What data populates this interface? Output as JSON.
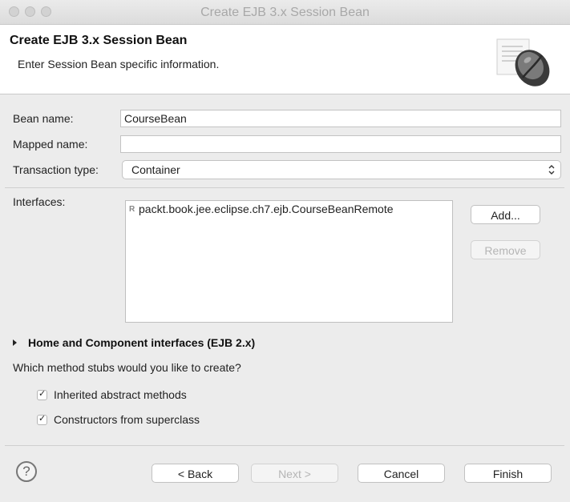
{
  "window": {
    "title": "Create EJB 3.x Session Bean"
  },
  "header": {
    "title": "Create EJB 3.x Session Bean",
    "description": "Enter Session Bean specific information."
  },
  "form": {
    "bean_name_label": "Bean name:",
    "bean_name_value": "CourseBean",
    "mapped_name_label": "Mapped name:",
    "mapped_name_value": "",
    "transaction_type_label": "Transaction type:",
    "transaction_type_value": "Container",
    "interfaces_label": "Interfaces:",
    "interfaces": [
      {
        "badge": "R",
        "name": "packt.book.jee.eclipse.ch7.ejb.CourseBeanRemote"
      }
    ],
    "add_button": "Add...",
    "remove_button": "Remove"
  },
  "home_section": {
    "label": "Home and Component interfaces (EJB 2.x)"
  },
  "stubs": {
    "question": "Which method stubs would you like to create?",
    "options": [
      {
        "label": "Inherited abstract methods",
        "checked": true
      },
      {
        "label": "Constructors from superclass",
        "checked": true
      }
    ]
  },
  "footer": {
    "help_symbol": "?",
    "back": "< Back",
    "next": "Next >",
    "cancel": "Cancel",
    "finish": "Finish"
  }
}
